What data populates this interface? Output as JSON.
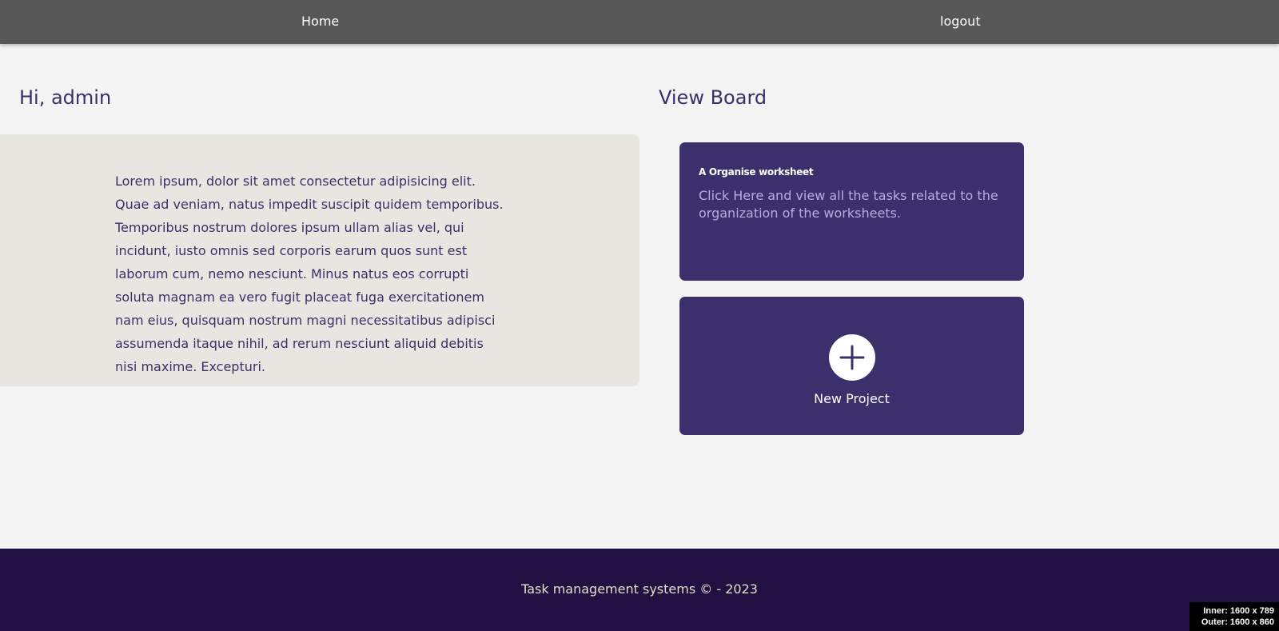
{
  "nav": {
    "home_label": "Home",
    "logout_label": "logout"
  },
  "greeting": "Hi, admin",
  "intro": {
    "text": "Lorem ipsum, dolor sit amet consectetur adipisicing elit. Quae ad veniam, natus impedit suscipit quidem temporibus. Temporibus nostrum dolores ipsum ullam alias vel, qui incidunt, iusto omnis sed corporis earum quos sunt est laborum cum, nemo nesciunt. Minus natus eos corrupti soluta magnam ea vero fugit placeat fuga exercitationem nam eius, quisquam nostrum magni necessitatibus adipisci assumenda itaque nihil, ad rerum nesciunt aliquid debitis nisi maxime. Excepturi."
  },
  "board": {
    "title": "View Board",
    "cards": [
      {
        "title": "A Organise worksheet",
        "description": "Click Here and view all the tasks related to the organization of the worksheets."
      }
    ],
    "new_project": {
      "icon": "plus-icon",
      "label": "New Project"
    }
  },
  "footer": {
    "text": "Task management systems © - 2023"
  },
  "viewport_badge": {
    "inner": "Inner: 1600 x 789",
    "outer": "Outer: 1600 x 860"
  },
  "colors": {
    "nav_bg": "#575757",
    "accent": "#3b306b",
    "heading_text": "#3a3068",
    "intro_bg": "#e8e6e1",
    "footer_bg": "#211042",
    "page_bg": "#f4f4f4"
  }
}
